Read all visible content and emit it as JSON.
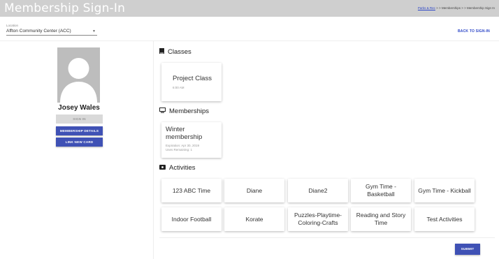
{
  "header": {
    "title": "Membership Sign-In",
    "breadcrumb": {
      "link": "Parks & Rec",
      "sep1": " > > ",
      "item2": "Memberships",
      "sep2": " > > ",
      "item3": "Membership Sign In"
    }
  },
  "location": {
    "label": "Location",
    "value": "Affton Community Center (ACC)"
  },
  "back_label": "BACK TO SIGN-IN",
  "member": {
    "name": "Josey Wales",
    "signin_label": "SIGN IN",
    "details_label": "MEMBERSHIP DETAILS",
    "link_card_label": "LINK NEW CARD"
  },
  "sections": {
    "classes": "Classes",
    "memberships": "Memberships",
    "activities": "Activities"
  },
  "classes": [
    {
      "name": "Project Class",
      "time": "6:00 AM"
    }
  ],
  "memberships": [
    {
      "name": "Winter membership",
      "expiration": "Expiration: Apr 30, 2019",
      "uses": "Uses Remaining: 1"
    }
  ],
  "activities": [
    "123 ABC Time",
    "Diane",
    "Diane2",
    "Gym Time - Basketball",
    "Gym Time - Kickball",
    "Indoor Football",
    "Korate",
    "Puzzles-Playtime-Coloring-Crafts",
    "Reading and Story Time",
    "Test Activities"
  ],
  "submit_label": "SUBMIT",
  "icons": {
    "location_caret": "caret-down-icon",
    "classes": "book-icon",
    "memberships": "monitor-icon",
    "activities": "ticket-icon",
    "avatar": "person-silhouette-icon"
  },
  "colors": {
    "primary": "#3f51b5",
    "header_bg": "#cfcfcf",
    "link": "#2a44c7"
  }
}
